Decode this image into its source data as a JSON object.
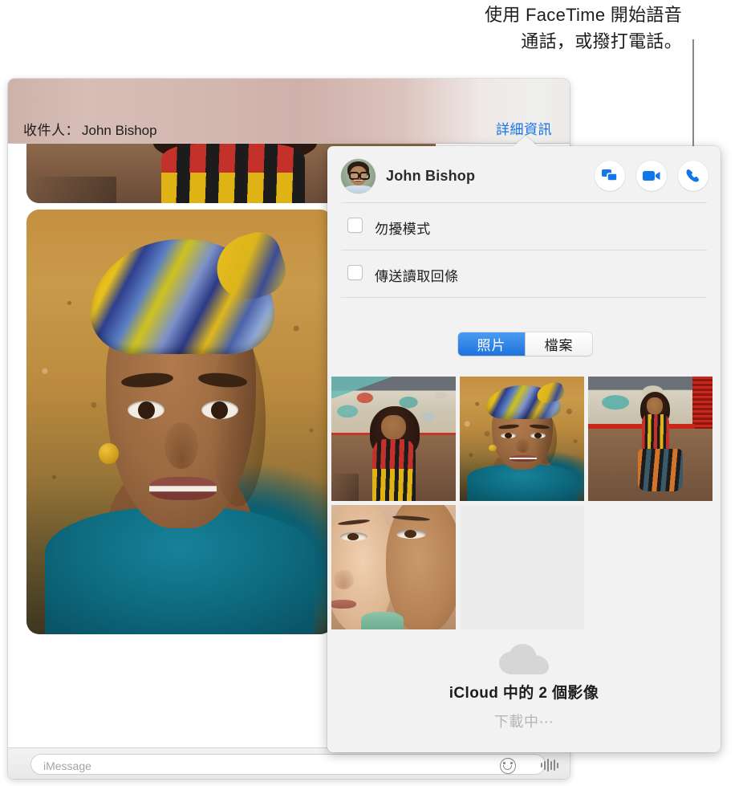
{
  "callout": {
    "text": "使用 FaceTime 開始語音\n通話，或撥打電話。"
  },
  "window": {
    "toolbar": {
      "recipient_label": "收件人：",
      "recipient_name": "John Bishop",
      "details_link": "詳細資訊"
    },
    "entry": {
      "placeholder": "iMessage",
      "value": "",
      "emoji_icon": "smiley-face-icon",
      "audio_icon": "audio-waveform-icon"
    }
  },
  "popover": {
    "contact_name": "John Bishop",
    "avatar_icon": "contact-avatar",
    "actions": [
      {
        "name": "screen-share-button",
        "icon": "screen-share-icon"
      },
      {
        "name": "video-call-button",
        "icon": "video-camera-icon"
      },
      {
        "name": "audio-call-button",
        "icon": "phone-handset-icon"
      }
    ],
    "options": [
      {
        "label": "勿擾模式",
        "checked": false
      },
      {
        "label": "傳送讀取回條",
        "checked": false
      }
    ],
    "segmented": {
      "selected": "照片",
      "options": [
        "照片",
        "檔案"
      ]
    },
    "attachments": [
      {
        "name": "photo-thumbnail-1",
        "art": "phB"
      },
      {
        "name": "photo-thumbnail-2",
        "art": "phA"
      },
      {
        "name": "photo-thumbnail-3",
        "art": "phC"
      },
      {
        "name": "photo-thumbnail-4",
        "art": "phD"
      },
      {
        "name": "photo-thumbnail-placeholder",
        "art": "empty"
      }
    ],
    "icloud": {
      "icon": "cloud-icon",
      "title": "iCloud 中的 2 個影像",
      "status": "下載中⋯"
    }
  },
  "colors": {
    "accent_blue": "#1673e6",
    "segment_blue": "#1f72dd",
    "popover_bg": "#f2f2f2",
    "toolbar_tint": "#d3b8b1"
  }
}
